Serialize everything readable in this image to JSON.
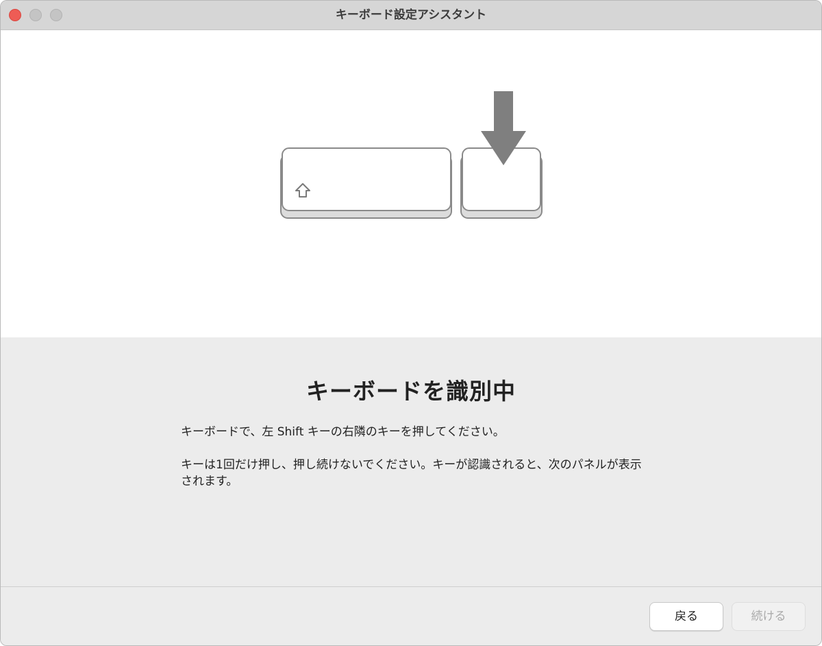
{
  "window": {
    "title": "キーボード設定アシスタント"
  },
  "illustration": {
    "left_key_symbol": "shift-arrow-icon",
    "target_indicator": "down-arrow-icon",
    "colors": {
      "key_face": "#ffffff",
      "key_border": "#8a8a8a",
      "key_shadow": "#dcdcdc",
      "arrow": "#7f7f7f"
    }
  },
  "content": {
    "heading": "キーボードを識別中",
    "instruction_1": "キーボードで、左 Shift キーの右隣のキーを押してください。",
    "instruction_2": "キーは1回だけ押し、押し続けないでください。キーが認識されると、次のパネルが表示されます。"
  },
  "buttons": {
    "back_label": "戻る",
    "continue_label": "続ける"
  }
}
